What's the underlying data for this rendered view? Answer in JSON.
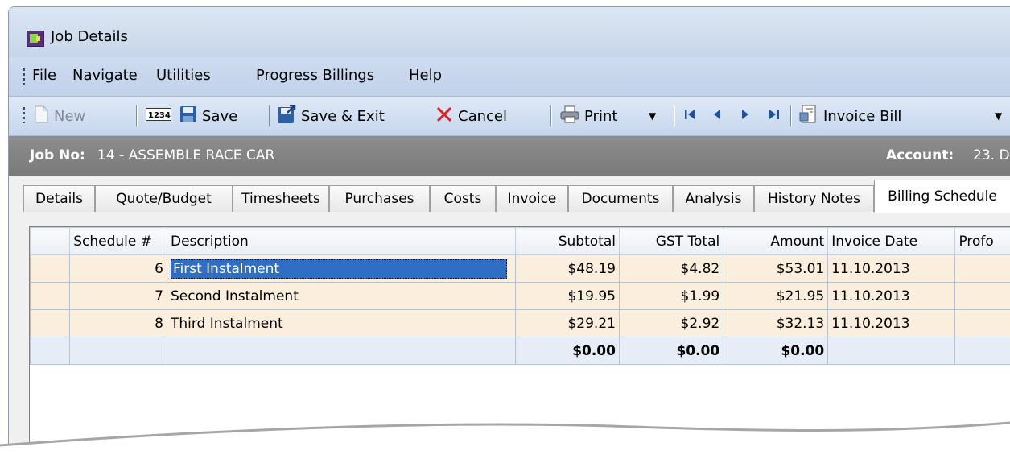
{
  "window": {
    "title": "Job Details"
  },
  "menu": [
    "File",
    "Navigate",
    "Utilities",
    "Progress Billings",
    "Help"
  ],
  "toolbar": {
    "new": "New",
    "save": "Save",
    "save_exit": "Save & Exit",
    "cancel": "Cancel",
    "print": "Print",
    "invoice_bill": "Invoice Bill"
  },
  "job": {
    "job_label": "Job No:",
    "job_value": "14 - ASSEMBLE RACE CAR",
    "account_label": "Account:",
    "account_value": "23. D"
  },
  "tabs": [
    "Details",
    "Quote/Budget",
    "Timesheets",
    "Purchases",
    "Costs",
    "Invoice",
    "Documents",
    "Analysis",
    "History Notes",
    "Billing Schedule"
  ],
  "active_tab": "Billing Schedule",
  "grid": {
    "headers": [
      "",
      "Schedule #",
      "Description",
      "Subtotal",
      "GST Total",
      "Amount",
      "Invoice Date",
      "Profo"
    ],
    "rows": [
      {
        "schedule": "6",
        "description": "First Instalment",
        "subtotal": "$48.19",
        "gst": "$4.82",
        "amount": "$53.01",
        "date": "11.10.2013"
      },
      {
        "schedule": "7",
        "description": "Second Instalment",
        "subtotal": "$19.95",
        "gst": "$1.99",
        "amount": "$21.95",
        "date": "11.10.2013"
      },
      {
        "schedule": "8",
        "description": "Third Instalment",
        "subtotal": "$29.21",
        "gst": "$2.92",
        "amount": "$32.13",
        "date": "11.10.2013"
      }
    ],
    "totals": {
      "subtotal": "$0.00",
      "gst": "$0.00",
      "amount": "$0.00"
    }
  },
  "colors": {
    "selection": "#2f6ec2",
    "row_bg": "#fbeedc",
    "job_bar": "#808080"
  }
}
